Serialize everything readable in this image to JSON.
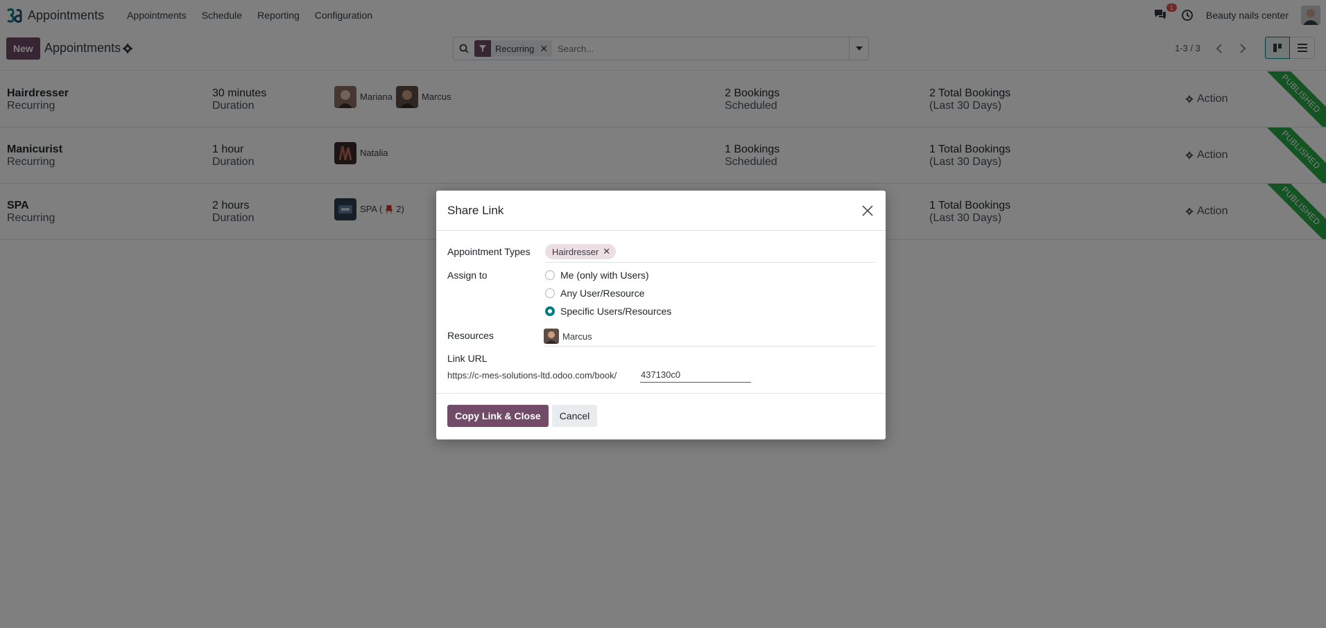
{
  "app": {
    "name": "Appointments"
  },
  "nav": {
    "items": [
      "Appointments",
      "Schedule",
      "Reporting",
      "Configuration"
    ]
  },
  "user": {
    "company": "Beauty nails center",
    "notification_count": "1"
  },
  "control": {
    "new_label": "New",
    "title": "Appointments",
    "facet_label": "Recurring",
    "search_placeholder": "Search...",
    "pager": "1-3 / 3"
  },
  "records": [
    {
      "name": "Hairdresser",
      "type": "Recurring",
      "duration": "30 minutes",
      "duration_label": "Duration",
      "staff": [
        "Mariana",
        "Marcus"
      ],
      "bookings": "2 Bookings",
      "bookings_label": "Scheduled",
      "total": "2 Total Bookings",
      "total_label": "(Last 30 Days)",
      "action": "Action",
      "ribbon": "PUBLISHED"
    },
    {
      "name": "Manicurist",
      "type": "Recurring",
      "duration": "1 hour",
      "duration_label": "Duration",
      "staff": [
        "Natalia"
      ],
      "bookings": "1 Bookings",
      "bookings_label": "Scheduled",
      "total": "1 Total Bookings",
      "total_label": "(Last 30 Days)",
      "action": "Action",
      "ribbon": "PUBLISHED"
    },
    {
      "name": "SPA",
      "type": "Recurring",
      "duration": "2 hours",
      "duration_label": "Duration",
      "staff": [
        "SPA (",
        "2)"
      ],
      "bookings": "",
      "bookings_label": "",
      "total": "1 Total Bookings",
      "total_label": "(Last 30 Days)",
      "action": "Action",
      "ribbon": "PUBLISHED"
    }
  ],
  "dialog": {
    "title": "Share Link",
    "appointment_types_label": "Appointment Types",
    "appointment_type_tag": "Hairdresser",
    "assign_to_label": "Assign to",
    "assign_options": [
      "Me (only with Users)",
      "Any User/Resource",
      "Specific Users/Resources"
    ],
    "selected_option": 2,
    "resources_label": "Resources",
    "resource": "Marcus",
    "link_url_label": "Link URL",
    "url_prefix": "https://c-mes-solutions-ltd.odoo.com/book/",
    "url_suffix": "437130c0",
    "copy_label": "Copy Link & Close",
    "cancel_label": "Cancel"
  },
  "colors": {
    "primary": "#714b67",
    "teal": "#017e84",
    "ribbon": "#28a745"
  }
}
